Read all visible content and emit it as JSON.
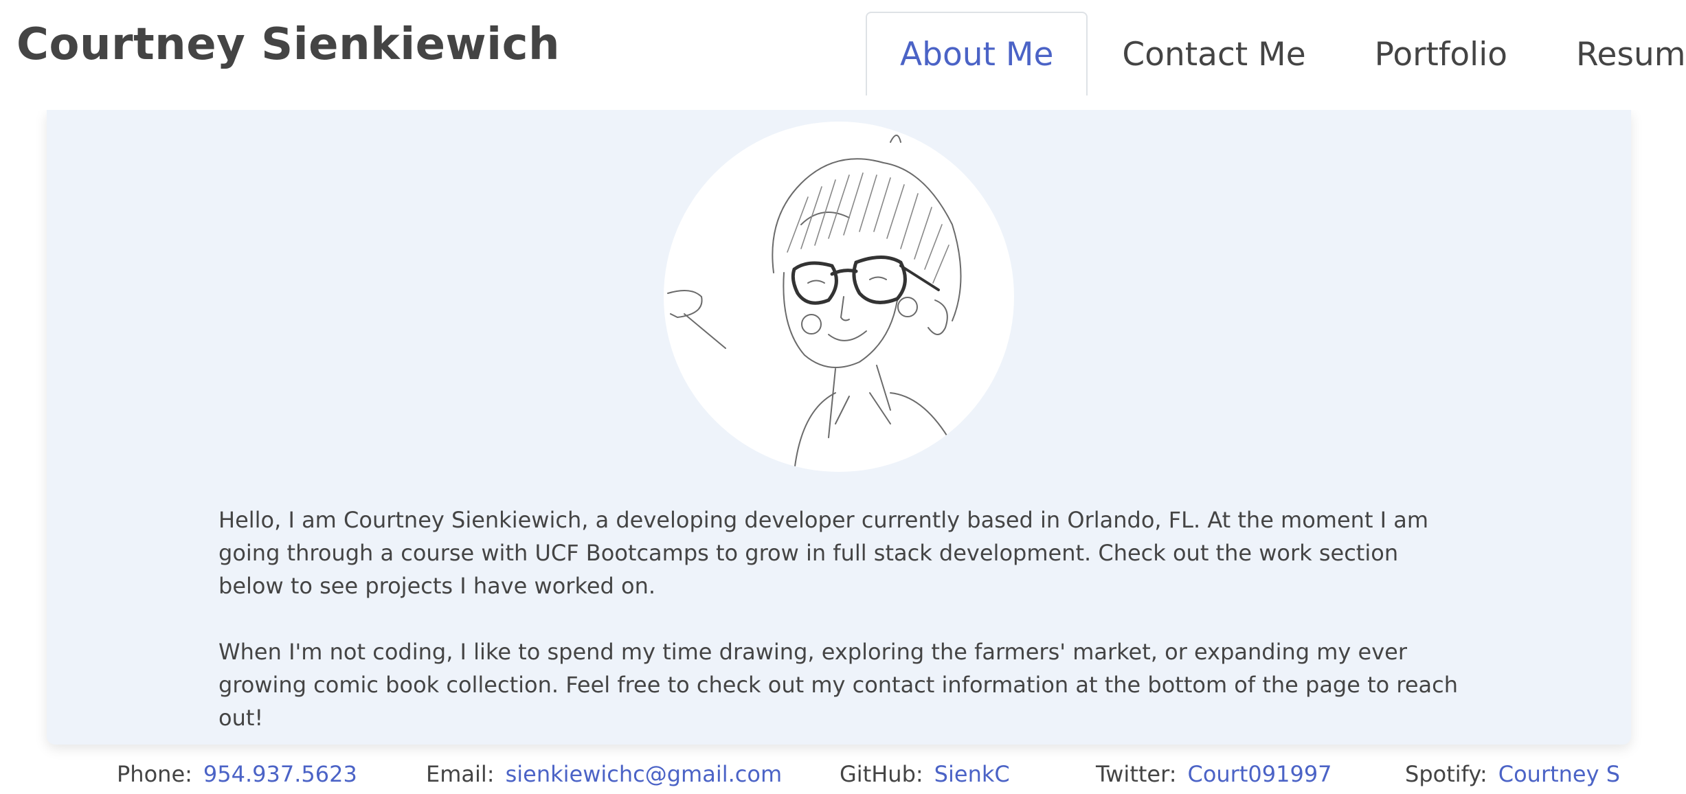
{
  "site": {
    "title": "Courtney Sienkiewich"
  },
  "nav": {
    "tabs": [
      {
        "label": "About Me",
        "active": true
      },
      {
        "label": "Contact Me",
        "active": false
      },
      {
        "label": "Portfolio",
        "active": false
      },
      {
        "label": "Resume",
        "active": false
      }
    ]
  },
  "about": {
    "avatar_icon": "pencil-sketch-portrait",
    "paragraphs": [
      "Hello, I am Courtney Sienkiewich, a developing developer currently based in Orlando, FL. At the moment I am going through a course with UCF Bootcamps to grow in full stack development. Check out the work section below to see projects I have worked on.",
      "When I'm not coding, I like to spend my time drawing, exploring the farmers' market, or expanding my ever growing comic book collection. Feel free to check out my contact information at the bottom of the page to reach out!"
    ]
  },
  "footer": {
    "phone": {
      "label": "Phone:",
      "value": "954.937.5623"
    },
    "email": {
      "label": "Email:",
      "value": "sienkiewichc@gmail.com"
    },
    "github": {
      "label": "GitHub:",
      "value": "SienkC"
    },
    "twitter": {
      "label": "Twitter:",
      "value": "Court091997"
    },
    "spotify": {
      "label": "Spotify:",
      "value": "Courtney S"
    }
  },
  "colors": {
    "accent": "#4b63c6",
    "text": "#444444",
    "card_background": "#eef3fa"
  }
}
